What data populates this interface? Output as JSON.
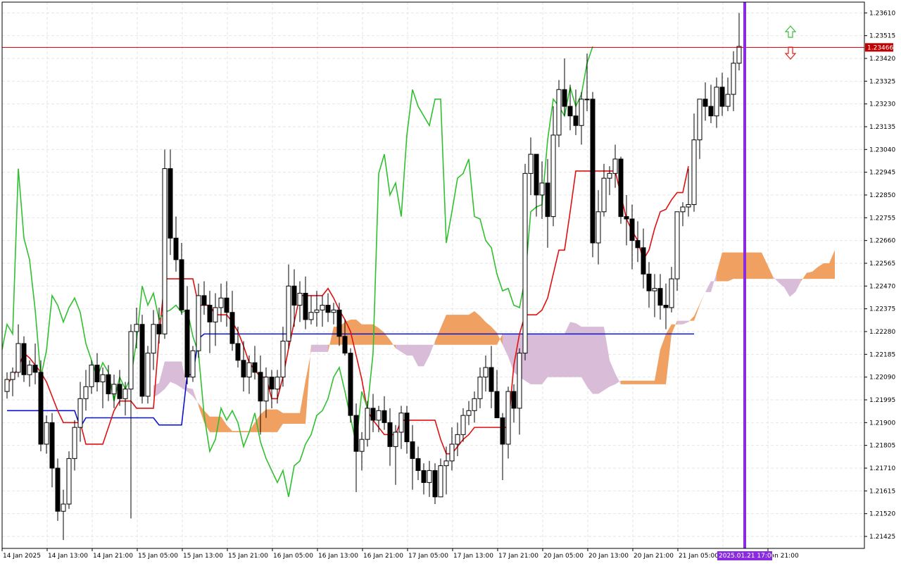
{
  "chart_data": {
    "type": "candlestick",
    "indicators": [
      "Ichimoku Kinko Hyo"
    ],
    "y_ticks": [
      "1.23610",
      "1.23515",
      "1.23420",
      "1.23325",
      "1.23230",
      "1.23135",
      "1.23040",
      "1.22945",
      "1.22850",
      "1.22755",
      "1.22660",
      "1.22565",
      "1.22470",
      "1.22375",
      "1.22280",
      "1.22185",
      "1.22090",
      "1.21995",
      "1.21900",
      "1.21805",
      "1.21710",
      "1.21615",
      "1.21520",
      "1.21425"
    ],
    "ylim": [
      1.21375,
      1.23655
    ],
    "x_ticks": [
      "14 Jan 2025",
      "14 Jan 13:00",
      "14 Jan 21:00",
      "15 Jan 05:00",
      "15 Jan 13:00",
      "15 Jan 21:00",
      "16 Jan 05:00",
      "16 Jan 13:00",
      "16 Jan 21:00",
      "17 Jan 05:00",
      "17 Jan 13:00",
      "17 Jan 21:00",
      "20 Jan 05:00",
      "20 Jan 13:00",
      "20 Jan 21:00",
      "21 Jan 05:00",
      "",
      "Jan 21:00"
    ],
    "current_price": "1.23466",
    "marker_label": "2025.01.21 17:00",
    "grid": true,
    "colors": {
      "bull": "#ffffff",
      "bear": "#000000",
      "tenkan": "#e01010",
      "kijun": "#0a14c8",
      "chikou": "#30c030",
      "cloud_bull": "#f0a060",
      "cloud_bear": "#d8bcd8",
      "price_line": "#c00000",
      "marker": "#8a2be2",
      "arrow_up": "#3cbc3c",
      "arrow_down": "#e02020"
    },
    "candles": [
      [
        1.2203,
        1.2211,
        1.22,
        1.2208
      ],
      [
        1.2208,
        1.2213,
        1.2201,
        1.2211
      ],
      [
        1.2211,
        1.2231,
        1.2209,
        1.2223
      ],
      [
        1.2223,
        1.2226,
        1.2207,
        1.221
      ],
      [
        1.221,
        1.2216,
        1.2205,
        1.2214
      ],
      [
        1.2214,
        1.2223,
        1.2206,
        1.2211
      ],
      [
        1.2211,
        1.2216,
        1.2178,
        1.2181
      ],
      [
        1.2181,
        1.2193,
        1.2177,
        1.219
      ],
      [
        1.219,
        1.2194,
        1.2163,
        1.2171
      ],
      [
        1.2171,
        1.2175,
        1.2149,
        1.2153
      ],
      [
        1.2153,
        1.2162,
        1.2141,
        1.2156
      ],
      [
        1.2156,
        1.2178,
        1.2154,
        1.2175
      ],
      [
        1.2175,
        1.2191,
        1.217,
        1.2188
      ],
      [
        1.2188,
        1.2207,
        1.2182,
        1.22
      ],
      [
        1.22,
        1.2212,
        1.2195,
        1.2205
      ],
      [
        1.2205,
        1.2216,
        1.2202,
        1.2214
      ],
      [
        1.2214,
        1.2219,
        1.2203,
        1.2207
      ],
      [
        1.2207,
        1.2213,
        1.2196,
        1.221
      ],
      [
        1.221,
        1.2214,
        1.2199,
        1.2202
      ],
      [
        1.2202,
        1.221,
        1.2196,
        1.2206
      ],
      [
        1.2206,
        1.2212,
        1.2197,
        1.22
      ],
      [
        1.22,
        1.2207,
        1.2193,
        1.2204
      ],
      [
        1.2204,
        1.2231,
        1.215,
        1.2228
      ],
      [
        1.2228,
        1.2238,
        1.2221,
        1.2231
      ],
      [
        1.2231,
        1.2235,
        1.2198,
        1.2201
      ],
      [
        1.2201,
        1.2222,
        1.2198,
        1.2219
      ],
      [
        1.2219,
        1.2237,
        1.2212,
        1.2231
      ],
      [
        1.2231,
        1.2238,
        1.2223,
        1.2227
      ],
      [
        1.2227,
        1.2304,
        1.2225,
        1.2296
      ],
      [
        1.2296,
        1.2304,
        1.226,
        1.2267
      ],
      [
        1.2267,
        1.2276,
        1.2253,
        1.2258
      ],
      [
        1.2258,
        1.2265,
        1.2235,
        1.2237
      ],
      [
        1.2237,
        1.2247,
        1.2206,
        1.2209
      ],
      [
        1.2209,
        1.2222,
        1.2207,
        1.222
      ],
      [
        1.222,
        1.2248,
        1.2217,
        1.2243
      ],
      [
        1.2243,
        1.2249,
        1.2235,
        1.2239
      ],
      [
        1.2239,
        1.2245,
        1.2219,
        1.2232
      ],
      [
        1.2232,
        1.2244,
        1.2222,
        1.2238
      ],
      [
        1.2238,
        1.2248,
        1.2232,
        1.2242
      ],
      [
        1.2242,
        1.2249,
        1.223,
        1.2236
      ],
      [
        1.2236,
        1.2245,
        1.222,
        1.2223
      ],
      [
        1.2223,
        1.223,
        1.2213,
        1.2216
      ],
      [
        1.2216,
        1.2224,
        1.2203,
        1.2209
      ],
      [
        1.2209,
        1.2218,
        1.2202,
        1.2215
      ],
      [
        1.2215,
        1.2222,
        1.2208,
        1.2211
      ],
      [
        1.2211,
        1.2218,
        1.2185,
        1.2199
      ],
      [
        1.2199,
        1.2213,
        1.2192,
        1.2209
      ],
      [
        1.2209,
        1.2212,
        1.2196,
        1.2204
      ],
      [
        1.2204,
        1.2212,
        1.2198,
        1.2209
      ],
      [
        1.2209,
        1.223,
        1.2205,
        1.2224
      ],
      [
        1.2224,
        1.2256,
        1.2221,
        1.2247
      ],
      [
        1.2247,
        1.2254,
        1.223,
        1.2239
      ],
      [
        1.2239,
        1.2249,
        1.2232,
        1.2244
      ],
      [
        1.2244,
        1.2251,
        1.2229,
        1.2233
      ],
      [
        1.2233,
        1.2243,
        1.2231,
        1.2236
      ],
      [
        1.2236,
        1.2245,
        1.223,
        1.2237
      ],
      [
        1.2237,
        1.2243,
        1.223,
        1.2239
      ],
      [
        1.2239,
        1.2244,
        1.2232,
        1.2236
      ],
      [
        1.2236,
        1.224,
        1.2231,
        1.2237
      ],
      [
        1.2237,
        1.224,
        1.2222,
        1.2226
      ],
      [
        1.2226,
        1.2233,
        1.2218,
        1.2219
      ],
      [
        1.2219,
        1.2221,
        1.219,
        1.2193
      ],
      [
        1.2193,
        1.2198,
        1.2161,
        1.2178
      ],
      [
        1.2178,
        1.2186,
        1.217,
        1.2183
      ],
      [
        1.2183,
        1.2199,
        1.218,
        1.2196
      ],
      [
        1.2196,
        1.2202,
        1.2186,
        1.2191
      ],
      [
        1.2191,
        1.2197,
        1.2186,
        1.2195
      ],
      [
        1.2195,
        1.2201,
        1.2187,
        1.219
      ],
      [
        1.219,
        1.2196,
        1.2172,
        1.218
      ],
      [
        1.218,
        1.2189,
        1.2164,
        1.2186
      ],
      [
        1.2186,
        1.2197,
        1.2179,
        1.2194
      ],
      [
        1.2194,
        1.2197,
        1.2177,
        1.2182
      ],
      [
        1.2182,
        1.2189,
        1.2162,
        1.2175
      ],
      [
        1.2175,
        1.218,
        1.2166,
        1.217
      ],
      [
        1.217,
        1.2173,
        1.216,
        1.2165
      ],
      [
        1.2165,
        1.2174,
        1.2159,
        1.217
      ],
      [
        1.217,
        1.2173,
        1.2156,
        1.2159
      ],
      [
        1.2159,
        1.2175,
        1.2159,
        1.2172
      ],
      [
        1.2172,
        1.218,
        1.216,
        1.2174
      ],
      [
        1.2174,
        1.2188,
        1.217,
        1.2181
      ],
      [
        1.2181,
        1.219,
        1.2176,
        1.2185
      ],
      [
        1.2185,
        1.2196,
        1.2182,
        1.2193
      ],
      [
        1.2193,
        1.2199,
        1.2189,
        1.2195
      ],
      [
        1.2195,
        1.2203,
        1.219,
        1.22
      ],
      [
        1.22,
        1.2213,
        1.2196,
        1.2209
      ],
      [
        1.2209,
        1.2218,
        1.2203,
        1.2213
      ],
      [
        1.2213,
        1.2222,
        1.2196,
        1.2203
      ],
      [
        1.2203,
        1.2212,
        1.2193,
        1.2192
      ],
      [
        1.2192,
        1.2194,
        1.2166,
        1.2181
      ],
      [
        1.2181,
        1.2205,
        1.2175,
        1.2203
      ],
      [
        1.2203,
        1.2206,
        1.219,
        1.2196
      ],
      [
        1.2196,
        1.2221,
        1.2185,
        1.2219
      ],
      [
        1.2219,
        1.2298,
        1.2216,
        1.2294
      ],
      [
        1.2294,
        1.2309,
        1.2285,
        1.2302
      ],
      [
        1.2302,
        1.2302,
        1.2276,
        1.2285
      ],
      [
        1.2285,
        1.2299,
        1.2275,
        1.229
      ],
      [
        1.229,
        1.23,
        1.2263,
        1.2276
      ],
      [
        1.2276,
        1.2322,
        1.2272,
        1.231
      ],
      [
        1.231,
        1.2333,
        1.2305,
        1.2329
      ],
      [
        1.2329,
        1.2342,
        1.2318,
        1.2322
      ],
      [
        1.2322,
        1.2331,
        1.2312,
        1.2318
      ],
      [
        1.2318,
        1.2329,
        1.231,
        1.2314
      ],
      [
        1.2314,
        1.2328,
        1.2306,
        1.2325
      ],
      [
        1.2325,
        1.2344,
        1.232,
        1.2325
      ],
      [
        1.2325,
        1.2328,
        1.2259,
        1.2265
      ],
      [
        1.2265,
        1.2287,
        1.2256,
        1.2278
      ],
      [
        1.2278,
        1.2298,
        1.2276,
        1.2292
      ],
      [
        1.2292,
        1.2297,
        1.2285,
        1.2294
      ],
      [
        1.2294,
        1.2306,
        1.2288,
        1.23
      ],
      [
        1.23,
        1.2301,
        1.2273,
        1.2276
      ],
      [
        1.2276,
        1.2285,
        1.2264,
        1.2275
      ],
      [
        1.2275,
        1.2281,
        1.2254,
        1.2266
      ],
      [
        1.2266,
        1.2274,
        1.2257,
        1.2263
      ],
      [
        1.2263,
        1.2271,
        1.2246,
        1.2252
      ],
      [
        1.2252,
        1.2257,
        1.2238,
        1.2245
      ],
      [
        1.2245,
        1.2252,
        1.2234,
        1.2246
      ],
      [
        1.2246,
        1.2252,
        1.2233,
        1.2239
      ],
      [
        1.2239,
        1.2248,
        1.2229,
        1.2238
      ],
      [
        1.2238,
        1.2255,
        1.2236,
        1.225
      ],
      [
        1.225,
        1.2275,
        1.2245,
        1.2278
      ],
      [
        1.2278,
        1.2282,
        1.2272,
        1.228
      ],
      [
        1.228,
        1.2296,
        1.2276,
        1.2281
      ],
      [
        1.2281,
        1.2319,
        1.2278,
        1.2308
      ],
      [
        1.2308,
        1.232,
        1.23,
        1.2325
      ],
      [
        1.2325,
        1.2332,
        1.2316,
        1.2322
      ],
      [
        1.2322,
        1.2331,
        1.2315,
        1.2318
      ],
      [
        1.2318,
        1.2334,
        1.2313,
        1.233
      ],
      [
        1.233,
        1.2336,
        1.2318,
        1.2322
      ],
      [
        1.2322,
        1.2334,
        1.232,
        1.2327
      ],
      [
        1.2327,
        1.2345,
        1.232,
        1.234
      ],
      [
        1.234,
        1.2361,
        1.2337,
        1.2347
      ]
    ],
    "tenkan": [
      1.2206,
      1.2209,
      1.2213,
      1.2219,
      1.2217,
      1.2214,
      1.2211,
      1.2207,
      1.2201,
      1.2195,
      1.219,
      1.219,
      1.219,
      1.219,
      1.2181,
      1.2181,
      1.2181,
      1.2181,
      1.2188,
      1.2195,
      1.2199,
      1.2199,
      1.2199,
      1.2196,
      1.2196,
      1.2196,
      1.2196,
      1.2226,
      1.225,
      1.225,
      1.225,
      1.225,
      1.225,
      1.225,
      1.2239,
      1.2239,
      1.2239,
      1.2235,
      1.2235,
      1.2235,
      1.2232,
      1.2228,
      1.2222,
      1.2215,
      1.2212,
      1.2209,
      1.2209,
      1.22,
      1.22,
      1.2209,
      1.2221,
      1.2232,
      1.2243,
      1.2243,
      1.2243,
      1.2243,
      1.2243,
      1.2246,
      1.2242,
      1.2237,
      1.2233,
      1.2228,
      1.2218,
      1.2208,
      1.2195,
      1.2191,
      1.2188,
      1.2185,
      1.2185,
      1.2185,
      1.2191,
      1.2191,
      1.2191,
      1.2191,
      1.2191,
      1.2191,
      1.2191,
      1.2183,
      1.2177,
      1.2177,
      1.218,
      1.2183,
      1.2185,
      1.2188,
      1.2188,
      1.2188,
      1.2188,
      1.2188,
      1.2188,
      1.2188,
      1.2214,
      1.2227,
      1.2235,
      1.2235,
      1.2235,
      1.2237,
      1.2242,
      1.2252,
      1.2262,
      1.2262,
      1.2278,
      1.2295,
      1.2295,
      1.2295,
      1.2295,
      1.2295,
      1.2295,
      1.2295,
      1.2295,
      1.2285,
      1.2275,
      1.227,
      1.2266,
      1.2258,
      1.2262,
      1.2271,
      1.2278,
      1.2279,
      1.2283,
      1.2286,
      1.2286,
      1.2297
    ],
    "kijun": [
      1.2195,
      1.2195,
      1.2195,
      1.2195,
      1.2195,
      1.2195,
      1.2195,
      1.2195,
      1.2195,
      1.2195,
      1.2195,
      1.2195,
      1.2195,
      1.2188,
      1.2192,
      1.2192,
      1.2192,
      1.2192,
      1.2192,
      1.2192,
      1.2192,
      1.2192,
      1.2192,
      1.2192,
      1.2192,
      1.2192,
      1.2192,
      1.2189,
      1.2189,
      1.2189,
      1.2189,
      1.2189,
      1.221,
      1.221,
      1.2225,
      1.2227,
      1.2227,
      1.2227,
      1.2227,
      1.2227,
      1.2227,
      1.2227,
      1.2227,
      1.2227,
      1.2227,
      1.2227,
      1.2227,
      1.2227,
      1.2227,
      1.2227,
      1.2227,
      1.2227,
      1.2227,
      1.2227,
      1.2227,
      1.2227,
      1.2227,
      1.2227,
      1.2227,
      1.2227,
      1.2227,
      1.2227,
      1.2227,
      1.2227,
      1.2227,
      1.2227,
      1.2227,
      1.2227,
      1.2227,
      1.2227,
      1.2227,
      1.2227,
      1.2227,
      1.2227,
      1.2227,
      1.2227,
      1.2227,
      1.2227,
      1.2227,
      1.2227,
      1.2227,
      1.2227,
      1.2227,
      1.2227,
      1.2227,
      1.2227,
      1.2227,
      1.2227,
      1.2227,
      1.2227,
      1.2227,
      1.2227,
      1.2227,
      1.2227,
      1.2227,
      1.2227,
      1.2227,
      1.2227,
      1.2227,
      1.2227,
      1.2227,
      1.2227,
      1.2227,
      1.2227,
      1.2227,
      1.2227,
      1.2227,
      1.2227,
      1.2227,
      1.2227,
      1.2227,
      1.2227,
      1.2227,
      1.2227,
      1.2227,
      1.2227,
      1.2227,
      1.2227,
      1.2227,
      1.2227,
      1.2227,
      1.2227,
      1.2227
    ]
  }
}
